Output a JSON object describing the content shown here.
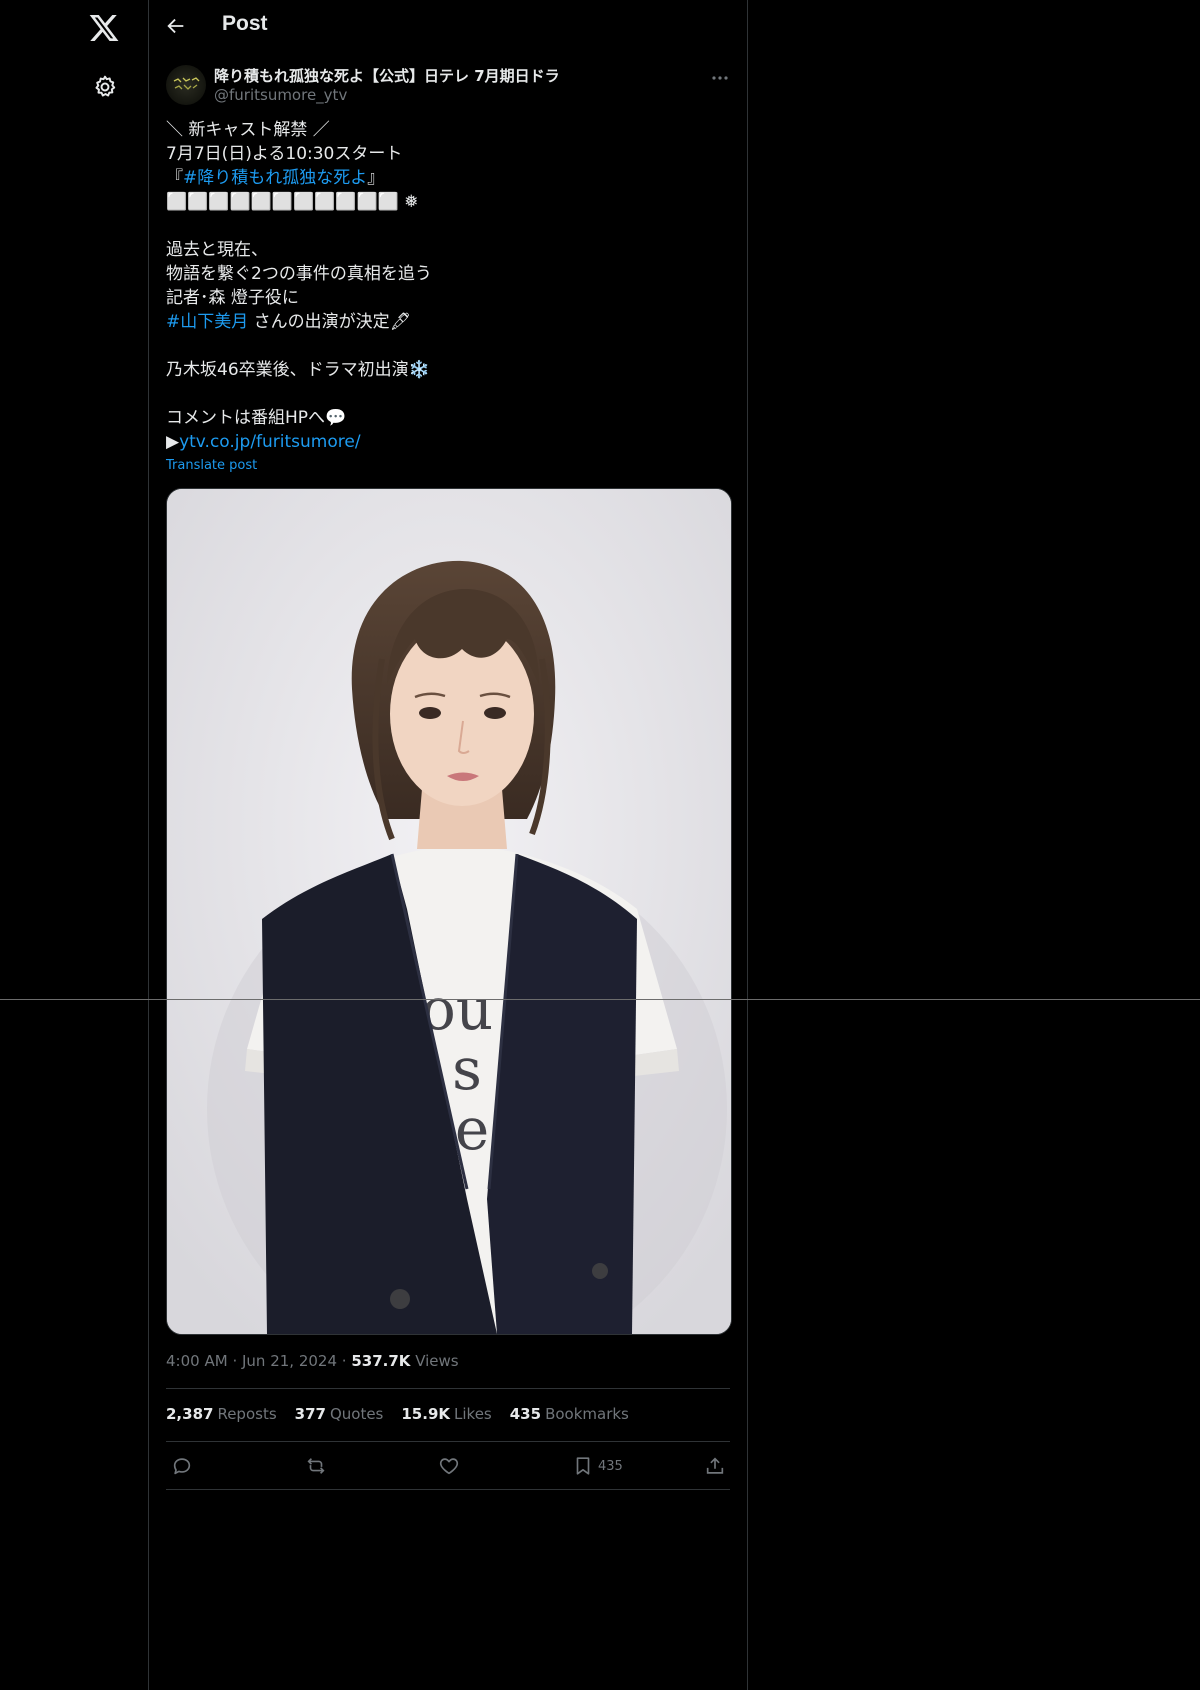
{
  "header": {
    "title": "Post"
  },
  "post": {
    "author_name": "降り積もれ孤独な死よ【公式】日テレ 7月期日ドラ",
    "author_handle": "@furitsumore_ytv",
    "lines": [
      {
        "text": "＼ 新キャスト解禁 ／"
      },
      {
        "text": "7月7日(日)よる10:30スタート"
      },
      {
        "pre": "『",
        "link": "#降り積もれ孤独な死よ",
        "post": "』"
      },
      {
        "text": "⬜⬜⬜⬜⬜⬜⬜⬜⬜⬜⬜ ❅"
      },
      {
        "blank": true
      },
      {
        "text": "過去と現在、"
      },
      {
        "text": "物語を繋ぐ2つの事件の真相を追う"
      },
      {
        "text": "記者･森 燈子役に"
      },
      {
        "link": "#山下美月",
        "post": " さんの出演が決定🖋"
      },
      {
        "blank": true
      },
      {
        "text": "乃木坂46卒業後、ドラマ初出演❄️"
      },
      {
        "blank": true
      },
      {
        "text": "コメントは番組HPへ💬"
      },
      {
        "pre": "▶",
        "link": "ytv.co.jp/furitsumore/"
      }
    ],
    "translate_label": "Translate post",
    "time": "4:00 AM",
    "date": "Jun 21, 2024",
    "views_count": "537.7K",
    "views_label": "Views",
    "stats": [
      {
        "count": "2,387",
        "label": "Reposts"
      },
      {
        "count": "377",
        "label": "Quotes"
      },
      {
        "count": "15.9K",
        "label": "Likes"
      },
      {
        "count": "435",
        "label": "Bookmarks"
      }
    ],
    "bookmark_action_count": "435"
  },
  "icons": {
    "logo": "x-logo-icon",
    "settings": "gear-icon",
    "back": "back-arrow-icon",
    "more": "more-dots-icon",
    "reply": "reply-icon",
    "repost": "repost-icon",
    "like": "heart-icon",
    "bookmark": "bookmark-icon",
    "share": "share-icon"
  },
  "colors": {
    "background": "#000000",
    "text": "#e7e9ea",
    "secondary": "#71767b",
    "accent": "#1d9bf0",
    "border": "#2f3336"
  }
}
